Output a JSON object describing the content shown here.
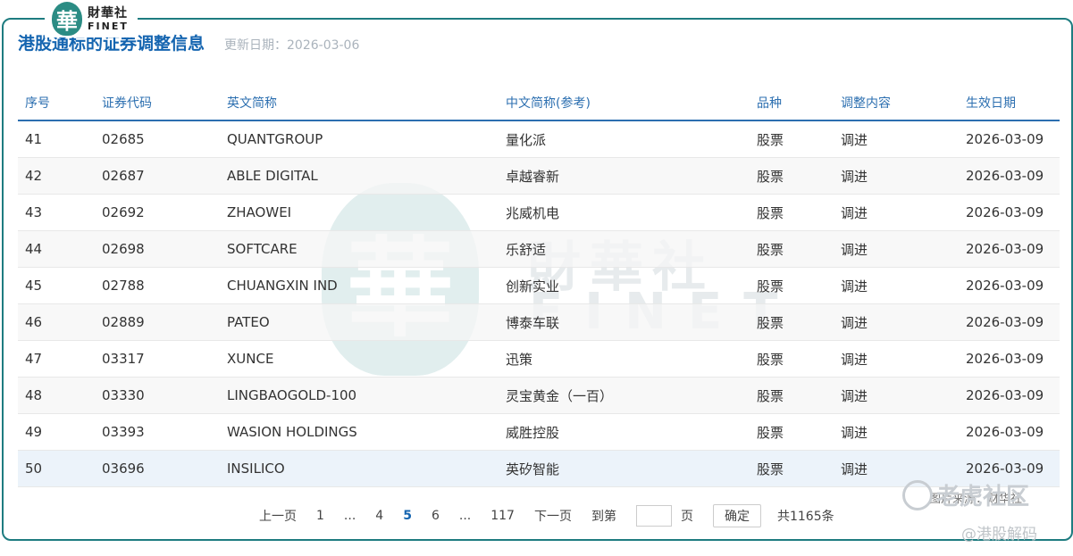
{
  "brand": {
    "mark": "華",
    "name_cn": "財華社",
    "name_en": "FINET"
  },
  "page": {
    "title": "港股通标的证券调整信息",
    "update_label": "更新日期：2026-03-06"
  },
  "watermark": {
    "mark": "華",
    "name_cn": "財華社",
    "name_en": "FINET"
  },
  "table": {
    "columns": [
      "序号",
      "证券代码",
      "英文简称",
      "中文简称(参考)",
      "品种",
      "调整内容",
      "生效日期"
    ],
    "rows": [
      [
        "41",
        "02685",
        "QUANTGROUP",
        "量化派",
        "股票",
        "调进",
        "2026-03-09"
      ],
      [
        "42",
        "02687",
        "ABLE DIGITAL",
        "卓越睿新",
        "股票",
        "调进",
        "2026-03-09"
      ],
      [
        "43",
        "02692",
        "ZHAOWEI",
        "兆威机电",
        "股票",
        "调进",
        "2026-03-09"
      ],
      [
        "44",
        "02698",
        "SOFTCARE",
        "乐舒适",
        "股票",
        "调进",
        "2026-03-09"
      ],
      [
        "45",
        "02788",
        "CHUANGXIN IND",
        "创新实业",
        "股票",
        "调进",
        "2026-03-09"
      ],
      [
        "46",
        "02889",
        "PATEO",
        "博泰车联",
        "股票",
        "调进",
        "2026-03-09"
      ],
      [
        "47",
        "03317",
        "XUNCE",
        "迅策",
        "股票",
        "调进",
        "2026-03-09"
      ],
      [
        "48",
        "03330",
        "LINGBAOGOLD-100",
        "灵宝黄金（一百）",
        "股票",
        "调进",
        "2026-03-09"
      ],
      [
        "49",
        "03393",
        "WASION HOLDINGS",
        "威胜控股",
        "股票",
        "调进",
        "2026-03-09"
      ],
      [
        "50",
        "03696",
        "INSILICO",
        "英矽智能",
        "股票",
        "调进",
        "2026-03-09"
      ]
    ]
  },
  "pager": {
    "prev": "上一页",
    "p1": "1",
    "ellipsis1": "...",
    "p4": "4",
    "p5": "5",
    "p6": "6",
    "ellipsis2": "...",
    "plast": "117",
    "next": "下一页",
    "goto": "到第",
    "page_unit": "页",
    "confirm": "确定",
    "total": "共1165条"
  },
  "image_source": "图片来源：财华社",
  "overlay": {
    "site": "老虎社区",
    "handle": "@港股解码"
  },
  "colors": {
    "accent": "#1565b0",
    "frame": "#1e7c80"
  }
}
